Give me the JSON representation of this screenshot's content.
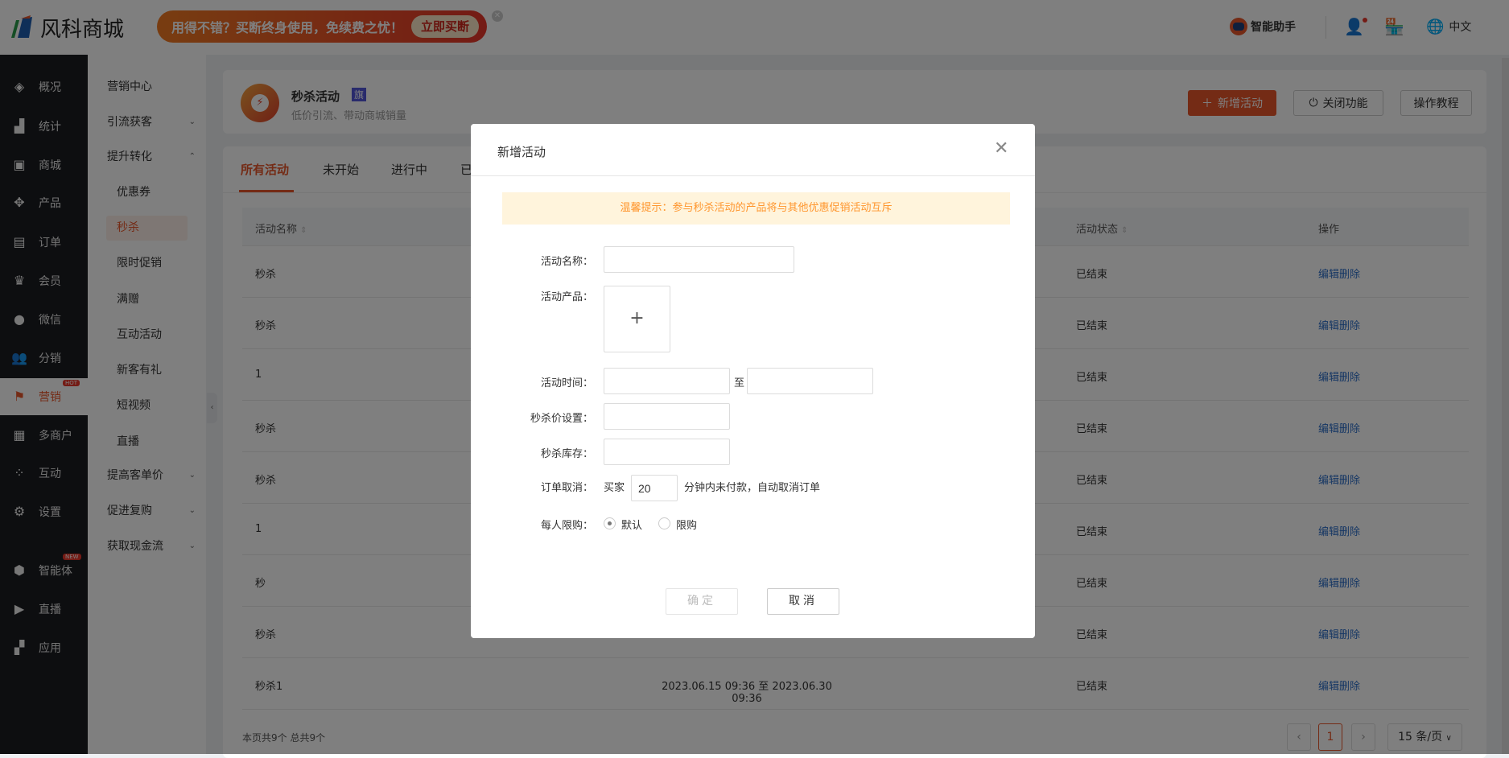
{
  "header": {
    "logo": "风科商城",
    "banner_text": "用得不错？买断终身使用，免续费之忧！",
    "banner_button": "立即买断",
    "assistant": "智能助手",
    "language": "中文"
  },
  "sidebar": {
    "items": [
      {
        "label": "概况",
        "icon": "layers-icon"
      },
      {
        "label": "统计",
        "icon": "chart-icon"
      },
      {
        "label": "商城",
        "icon": "shop-icon"
      },
      {
        "label": "产品",
        "icon": "grid-icon"
      },
      {
        "label": "订单",
        "icon": "order-icon"
      },
      {
        "label": "会员",
        "icon": "crown-icon"
      },
      {
        "label": "微信",
        "icon": "wechat-icon"
      },
      {
        "label": "分销",
        "icon": "users-icon"
      },
      {
        "label": "营销",
        "icon": "flag-icon",
        "badge": "HOT"
      },
      {
        "label": "多商户",
        "icon": "merchant-icon"
      },
      {
        "label": "互动",
        "icon": "interact-icon"
      },
      {
        "label": "设置",
        "icon": "gear-icon"
      },
      {
        "label": "智能体",
        "icon": "cube-icon",
        "badge": "NEW"
      },
      {
        "label": "直播",
        "icon": "tv-icon"
      },
      {
        "label": "应用",
        "icon": "apps-icon"
      }
    ]
  },
  "submenu": {
    "items": [
      {
        "label": "营销中心"
      },
      {
        "label": "引流获客",
        "chev": "⌄"
      },
      {
        "label": "提升转化",
        "chev": "⌃"
      },
      {
        "label": "优惠券"
      },
      {
        "label": "秒杀"
      },
      {
        "label": "限时促销"
      },
      {
        "label": "满赠"
      },
      {
        "label": "互动活动"
      },
      {
        "label": "新客有礼"
      },
      {
        "label": "短视频"
      },
      {
        "label": "直播"
      },
      {
        "label": "提高客单价",
        "chev": "⌄"
      },
      {
        "label": "促进复购",
        "chev": "⌄"
      },
      {
        "label": "获取现金流",
        "chev": "⌄"
      }
    ]
  },
  "page": {
    "title": "秒杀活动",
    "badge": "旗",
    "subtitle": "低价引流、带动商城销量",
    "add_button": "新增活动",
    "close_button": "关闭功能",
    "tutorial_button": "操作教程"
  },
  "tabs": [
    "所有活动",
    "未开始",
    "进行中",
    "已"
  ],
  "table": {
    "headers": [
      "活动名称",
      "活动状态",
      "操作"
    ],
    "rows": [
      {
        "name": "秒杀",
        "time": "",
        "status": "已结束",
        "action": "编辑删除"
      },
      {
        "name": "秒杀",
        "time": "",
        "status": "已结束",
        "action": "编辑删除"
      },
      {
        "name": "1",
        "time": "",
        "status": "已结束",
        "action": "编辑删除"
      },
      {
        "name": "秒杀",
        "time": "",
        "status": "已结束",
        "action": "编辑删除"
      },
      {
        "name": "秒杀",
        "time": "",
        "status": "已结束",
        "action": "编辑删除"
      },
      {
        "name": "1",
        "time": "",
        "status": "已结束",
        "action": "编辑删除"
      },
      {
        "name": "秒",
        "time": "",
        "status": "已结束",
        "action": "编辑删除"
      },
      {
        "name": "秒杀",
        "time": "",
        "status": "已结束",
        "action": "编辑删除"
      },
      {
        "name": "秒杀1",
        "time": "2023.06.15 09:36 至 2023.06.30 09:36",
        "status": "已结束",
        "action": "编辑删除"
      }
    ]
  },
  "footer": {
    "summary": "本页共9个 总共9个",
    "current_page": "1",
    "page_size": "15 条/页"
  },
  "dialog": {
    "title": "新增活动",
    "notice": "温馨提示：参与秒杀活动的产品将与其他优惠促销活动互斥",
    "labels": {
      "name": "活动名称：",
      "product": "活动产品：",
      "time": "活动时间：",
      "to": "至",
      "price": "秒杀价设置：",
      "stock": "秒杀库存：",
      "cancel": "订单取消：",
      "buyer": "买家",
      "cancel_suffix": "分钟内未付款，自动取消订单",
      "limit": "每人限购：",
      "opt_default": "默认",
      "opt_limit": "限购"
    },
    "cancel_minutes": "20",
    "confirm": "确定",
    "cancel_btn": "取消",
    "add_symbol": "+"
  }
}
